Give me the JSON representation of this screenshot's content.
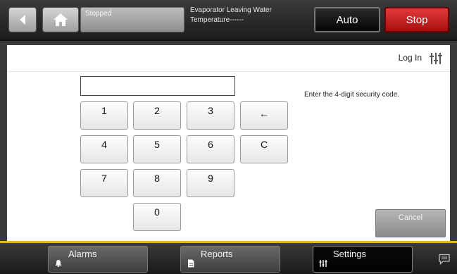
{
  "header": {
    "status": "Stopped",
    "info_line1": "Evaporator Leaving Water",
    "info_line2": "Temperature------",
    "auto_label": "Auto",
    "stop_label": "Stop"
  },
  "panel": {
    "login_label": "Log In",
    "code_value": "",
    "prompt": "Enter the 4-digit security code.",
    "cancel_label": "Cancel",
    "keys": {
      "k1": "1",
      "k2": "2",
      "k3": "3",
      "back": "←",
      "k4": "4",
      "k5": "5",
      "k6": "6",
      "clear": "C",
      "k7": "7",
      "k8": "8",
      "k9": "9",
      "k0": "0"
    }
  },
  "bottom": {
    "alarms": "Alarms",
    "reports": "Reports",
    "settings": "Settings"
  },
  "icons": {
    "back": "back-arrow-icon",
    "home": "home-icon",
    "settings": "sliders-icon",
    "alarms": "bell-icon",
    "reports": "document-icon",
    "chat": "chat-bubble-icon"
  },
  "colors": {
    "accent_gold": "#e8b52a",
    "stop_red": "#c41e1e",
    "panel_bg": "#ffffff"
  }
}
